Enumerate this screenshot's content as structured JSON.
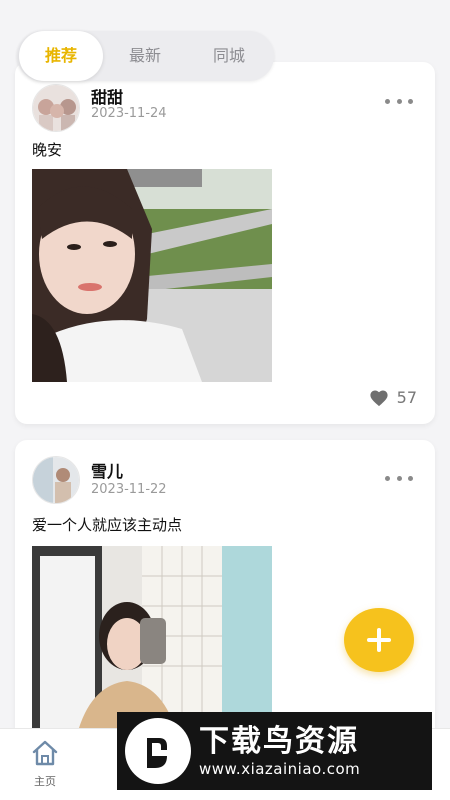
{
  "tabs": [
    {
      "label": "推荐",
      "active": true
    },
    {
      "label": "最新",
      "active": false
    },
    {
      "label": "同城",
      "active": false
    }
  ],
  "posts": [
    {
      "username": "甜甜",
      "date": "2023-11-24",
      "caption": "晚安",
      "likes": "57"
    },
    {
      "username": "雪儿",
      "date": "2023-11-22",
      "caption": "爱一个人就应该主动点"
    }
  ],
  "fab": {
    "icon": "plus-icon"
  },
  "nav": {
    "home_label": "主页",
    "home_icon": "home-icon"
  },
  "watermark": {
    "title": "下载鸟资源",
    "url": "www.xiazainiao.com"
  },
  "colors": {
    "accent": "#f6c21d",
    "active_tab_text": "#e8b500"
  }
}
